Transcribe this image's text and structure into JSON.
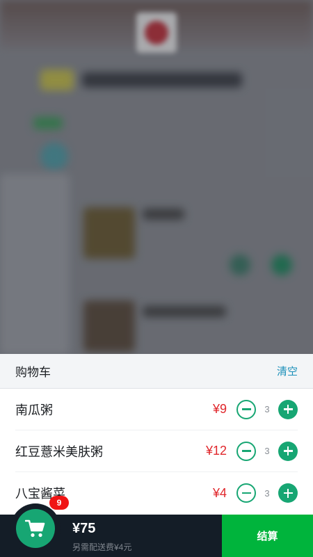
{
  "cart": {
    "title": "购物车",
    "clear_label": "清空",
    "items": [
      {
        "name": "南瓜粥",
        "price": "¥9",
        "quantity": "3"
      },
      {
        "name": "红豆薏米美肤粥",
        "price": "¥12",
        "quantity": "3"
      },
      {
        "name": "八宝酱菜",
        "price": "¥4",
        "quantity": "3"
      }
    ]
  },
  "bottom_bar": {
    "badge_count": "9",
    "total": "¥75",
    "delivery_fee": "另需配送费¥4元",
    "checkout_label": "结算"
  },
  "colors": {
    "accent_green": "#17a673",
    "checkout_green": "#00b43c",
    "price_red": "#e0262b",
    "bar_dark": "#141d27",
    "link_blue": "#1a8fb9"
  },
  "icons": [
    "cart-icon",
    "minus-icon",
    "plus-icon"
  ]
}
